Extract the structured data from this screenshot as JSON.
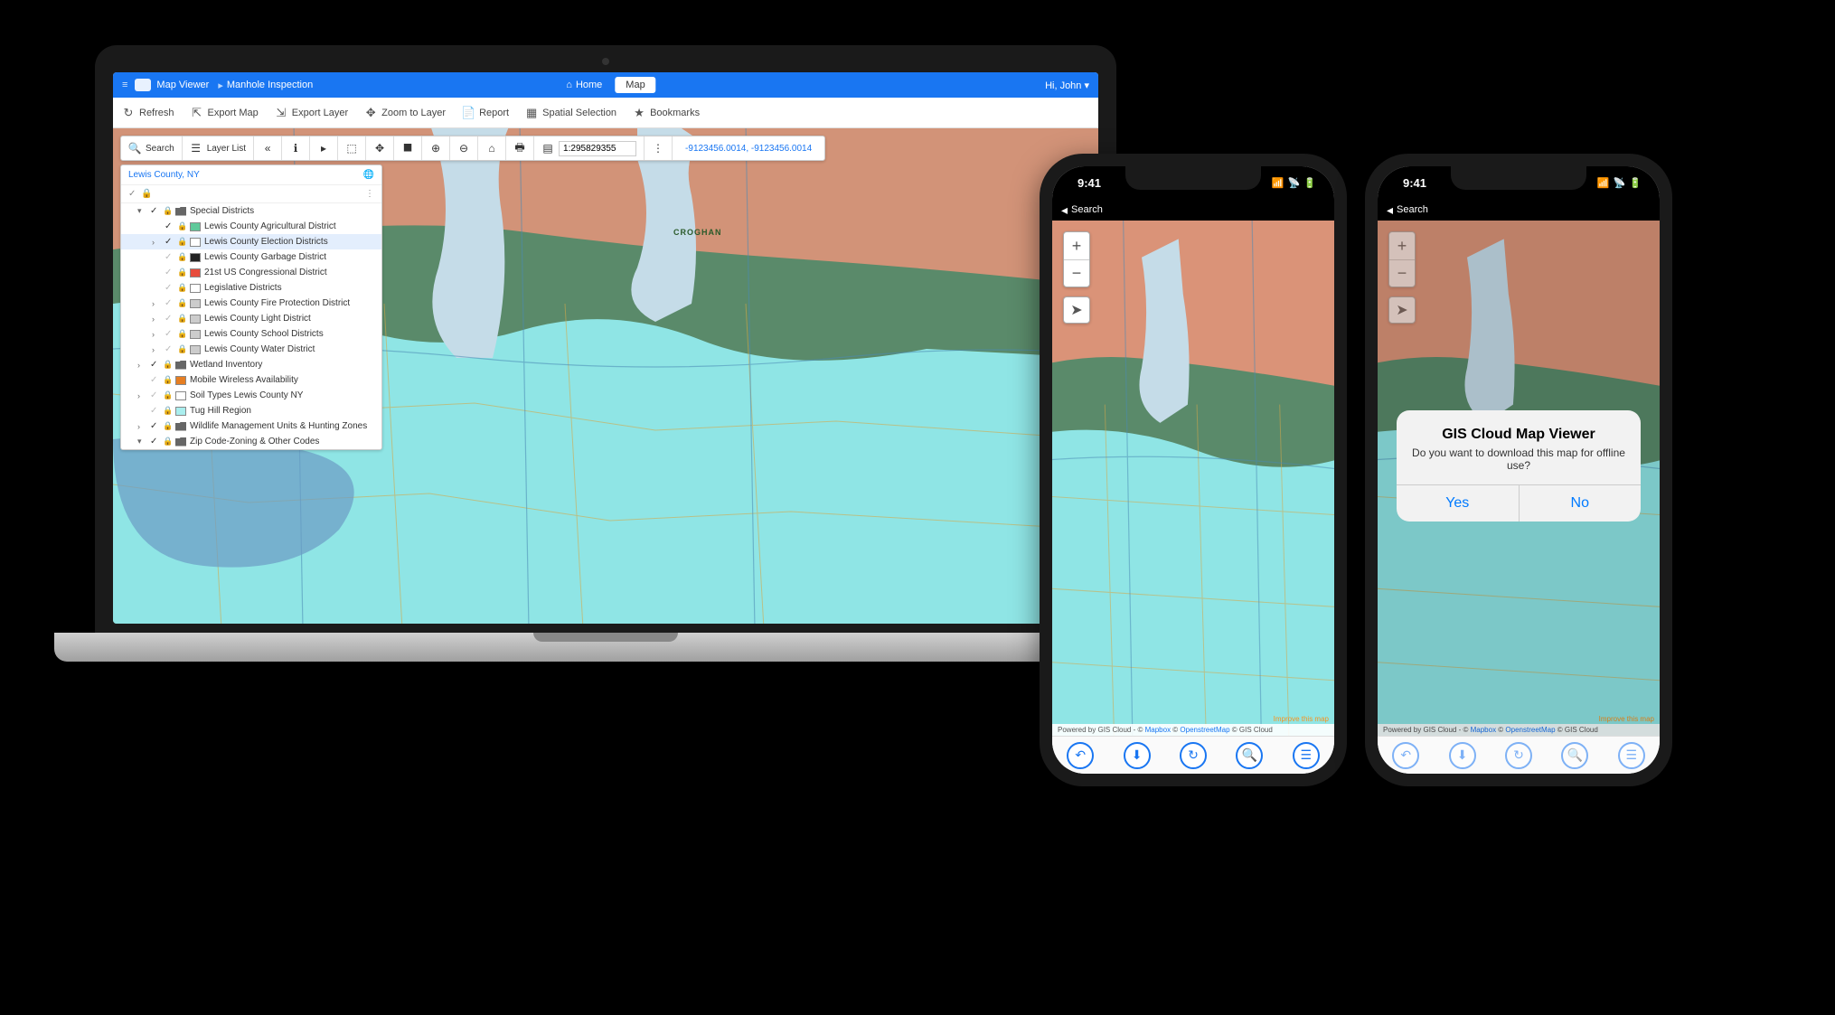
{
  "header": {
    "app": "Map Viewer",
    "project": "Manhole Inspection",
    "tabs": [
      {
        "icon": "home",
        "label": "Home",
        "active": false
      },
      {
        "icon": "",
        "label": "Map",
        "active": true
      }
    ],
    "user_label": "Hi, John ▾"
  },
  "toolbar": [
    {
      "icon": "↻",
      "label": "Refresh"
    },
    {
      "icon": "⇱",
      "label": "Export Map"
    },
    {
      "icon": "⇲",
      "label": "Export Layer"
    },
    {
      "icon": "✥",
      "label": "Zoom to Layer"
    },
    {
      "icon": "📄",
      "label": "Report"
    },
    {
      "icon": "▦",
      "label": "Spatial Selection"
    },
    {
      "icon": "★",
      "label": "Bookmarks"
    }
  ],
  "map_toolbar": {
    "search_label": "Search",
    "layer_list_label": "Layer List",
    "scale_value": "1:295829355",
    "coords": "-9123456.0014, -9123456.0014"
  },
  "panel": {
    "title": "Lewis County, NY",
    "layers": [
      {
        "indent": 1,
        "exp": "▾",
        "chk": true,
        "type": "folder",
        "label": "Special Districts"
      },
      {
        "indent": 2,
        "exp": "",
        "chk": true,
        "swatch": "#5fc99a",
        "label": "Lewis County Agricultural District"
      },
      {
        "indent": 2,
        "exp": "›",
        "chk": true,
        "swatch": "#ffffff",
        "label": "Lewis County Election Districts",
        "selected": true
      },
      {
        "indent": 2,
        "exp": "",
        "chk": false,
        "swatch": "#222222",
        "label": "Lewis County Garbage District"
      },
      {
        "indent": 2,
        "exp": "",
        "chk": false,
        "swatch": "#e74c3c",
        "label": "21st US Congressional District"
      },
      {
        "indent": 2,
        "exp": "",
        "chk": false,
        "swatch": "#ffffff",
        "label": "Legislative Districts"
      },
      {
        "indent": 2,
        "exp": "›",
        "chk": false,
        "swatch": "#cccccc",
        "label": "Lewis County Fire Protection District"
      },
      {
        "indent": 2,
        "exp": "›",
        "chk": false,
        "swatch": "#cccccc",
        "label": "Lewis County Light District"
      },
      {
        "indent": 2,
        "exp": "›",
        "chk": false,
        "swatch": "#cccccc",
        "label": "Lewis County School Districts"
      },
      {
        "indent": 2,
        "exp": "›",
        "chk": false,
        "swatch": "#cccccc",
        "label": "Lewis County Water District"
      },
      {
        "indent": 1,
        "exp": "›",
        "chk": true,
        "type": "folder",
        "label": "Wetland Inventory"
      },
      {
        "indent": 1,
        "exp": "",
        "chk": false,
        "swatch": "#e67e22",
        "label": "Mobile Wireless Availability"
      },
      {
        "indent": 1,
        "exp": "›",
        "chk": false,
        "swatch": "#ffffff",
        "label": "Soil Types Lewis County NY"
      },
      {
        "indent": 1,
        "exp": "",
        "chk": false,
        "swatch": "#aee",
        "label": "Tug Hill Region"
      },
      {
        "indent": 1,
        "exp": "›",
        "chk": true,
        "type": "folder",
        "label": "Wildlife Management Units & Hunting Zones"
      },
      {
        "indent": 1,
        "exp": "▾",
        "chk": true,
        "type": "folder",
        "label": "Zip Code-Zoning & Other Codes"
      }
    ]
  },
  "map": {
    "place_label": "CROGHAN"
  },
  "phone": {
    "time": "9:41",
    "nav_back": "Search",
    "zoom_in": "+",
    "zoom_out": "−",
    "attribution_prefix": "Powered by GIS Cloud - © ",
    "mapbox": "Mapbox",
    "osm_prefix": " © ",
    "osm": "OpenstreetMap",
    "giscloud_suffix": " © GIS Cloud",
    "improve": "Improve this map",
    "footer_icons": [
      "↶",
      "⬇",
      "↻",
      "🔍",
      "☰"
    ]
  },
  "alert": {
    "title": "GIS Cloud Map Viewer",
    "message": "Do you want to download this map for offline use?",
    "yes": "Yes",
    "no": "No"
  }
}
